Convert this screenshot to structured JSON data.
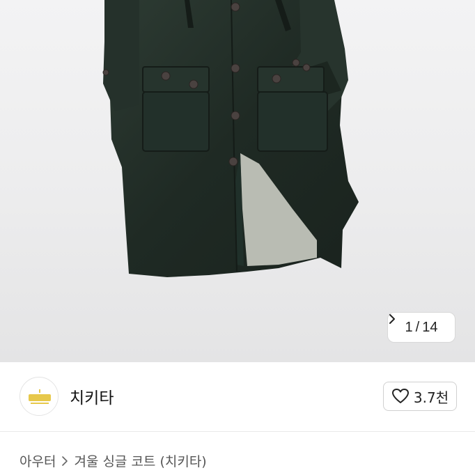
{
  "gallery": {
    "current": "1",
    "separator": "/",
    "total": "14",
    "next_icon": "chevron-right-icon"
  },
  "seller": {
    "name": "치키타",
    "avatar_icon": "shop-logo"
  },
  "like": {
    "icon": "heart-outline-icon",
    "count": "3.7천"
  },
  "breadcrumb": {
    "category": "아우터",
    "separator_icon": "chevron-right-icon",
    "title": "겨울 싱글 코트 (치키타)"
  },
  "colors": {
    "coat": "#23302a",
    "lining": "#b9bcb3",
    "background": "#ededee"
  }
}
